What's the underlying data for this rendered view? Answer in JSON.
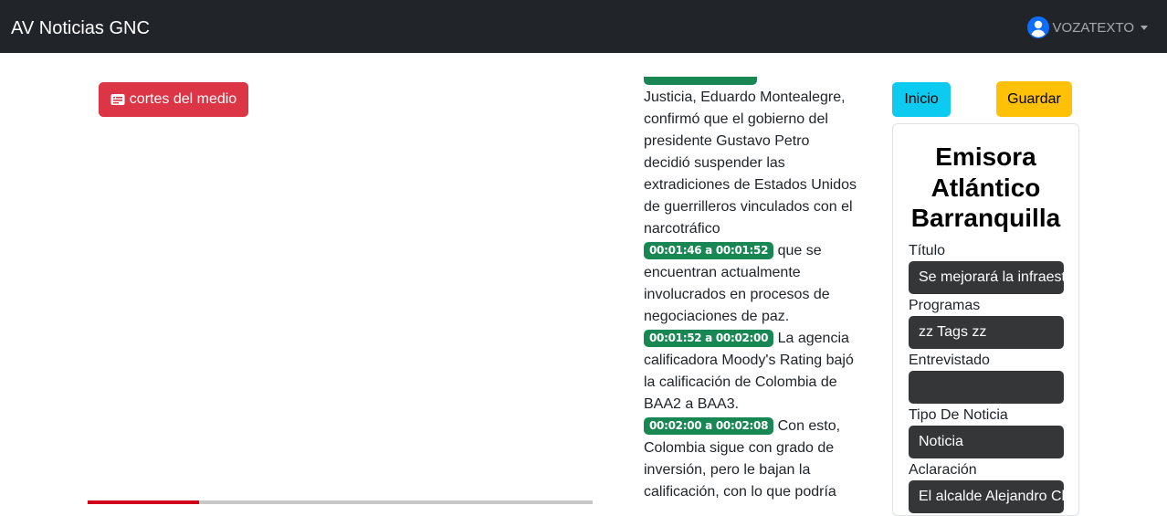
{
  "navbar": {
    "brand": "AV Noticias GNC",
    "user": "VOZATEXTO"
  },
  "media": {
    "cortes_label": "cortes del medio",
    "progress": 0.22
  },
  "transcript": {
    "intro": "Justicia, Eduardo Montealegre, confirmó que el gobierno del presidente Gustavo Petro decidió suspender las extradiciones de Estados Unidos de guerrilleros vinculados con el narcotráfico",
    "segments": [
      {
        "time": "00:01:46 a 00:01:52",
        "text": "que se encuentran actualmente involucrados en procesos de negociaciones de paz."
      },
      {
        "time": "00:01:52 a 00:02:00",
        "text": "La agencia calificadora Moody's Rating bajó la calificación de Colombia de BAA2 a BAA3."
      },
      {
        "time": "00:02:00 a 00:02:08",
        "text": "Con esto, Colombia sigue con grado de inversión, pero le bajan la calificación, con lo que podría"
      }
    ]
  },
  "actions": {
    "inicio": "Inicio",
    "guardar": "Guardar"
  },
  "form": {
    "station": "Emisora Atlántico Barranquilla",
    "titulo_label": "Título",
    "titulo_value": "Se mejorará la infraestructura",
    "programas_label": "Programas",
    "programas_value": "zz Tags zz",
    "entrevistado_label": "Entrevistado",
    "entrevistado_value": "",
    "tipo_label": "Tipo De Noticia",
    "tipo_value": "Noticia",
    "aclaracion_label": "Aclaración",
    "aclaracion_value": "El alcalde Alejandro Char"
  },
  "colors": {
    "navbar": "#212529",
    "danger": "#dc3545",
    "success": "#198754",
    "info": "#0dcaf0",
    "warning": "#ffc107",
    "field": "#343638"
  },
  "icons": {
    "user": "person-circle-icon",
    "cortes": "card-text-icon",
    "dropdown": "caret-down-icon"
  }
}
